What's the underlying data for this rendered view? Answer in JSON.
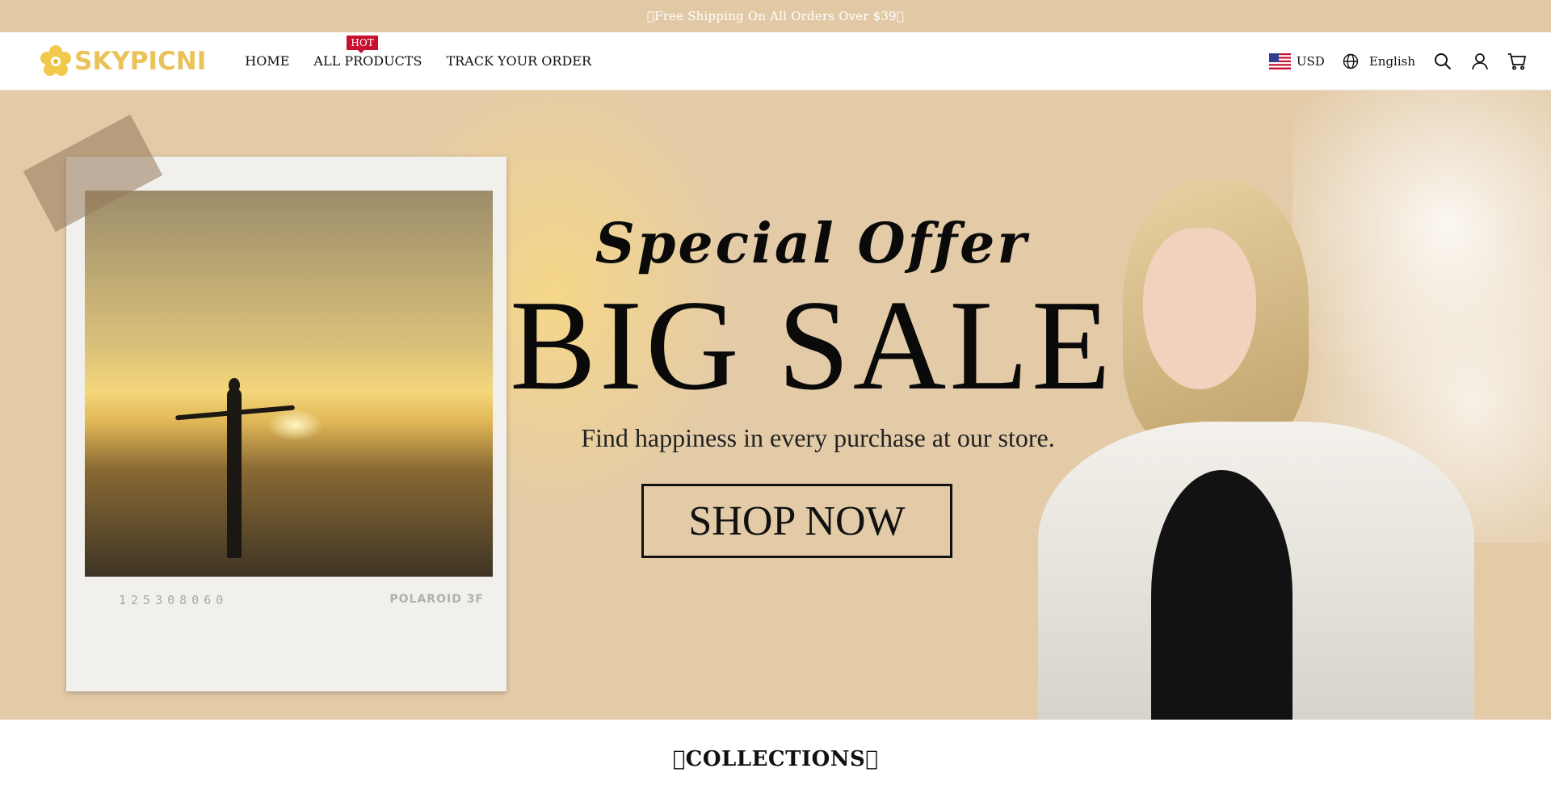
{
  "announcement": {
    "text": "\u0000Free Shipping On All Orders Over $39\u0000"
  },
  "header": {
    "logo_text": "SKYPICNI",
    "nav": [
      {
        "label": "HOME"
      },
      {
        "label": "ALL PRODUCTS",
        "badge": "HOT"
      },
      {
        "label": "TRACK YOUR ORDER"
      }
    ],
    "currency": "USD",
    "language": "English",
    "icons": [
      "globe-icon",
      "search-icon",
      "account-icon",
      "cart-icon"
    ]
  },
  "hero": {
    "heading_script": "Special Offer",
    "heading_main": "BIG SALE",
    "tagline": "Find happiness in every purchase at our store.",
    "cta_label": "SHOP NOW",
    "polaroid_code": "125308060",
    "polaroid_brand": "POLAROID 3F"
  },
  "collections_heading": "\u0000COLLECTIONS\u0000",
  "colors": {
    "announcement_bg": "#e2c9a6",
    "hero_bg": "#e3cba8",
    "logo": "#e9c35a",
    "hot_badge": "#c8102e"
  }
}
